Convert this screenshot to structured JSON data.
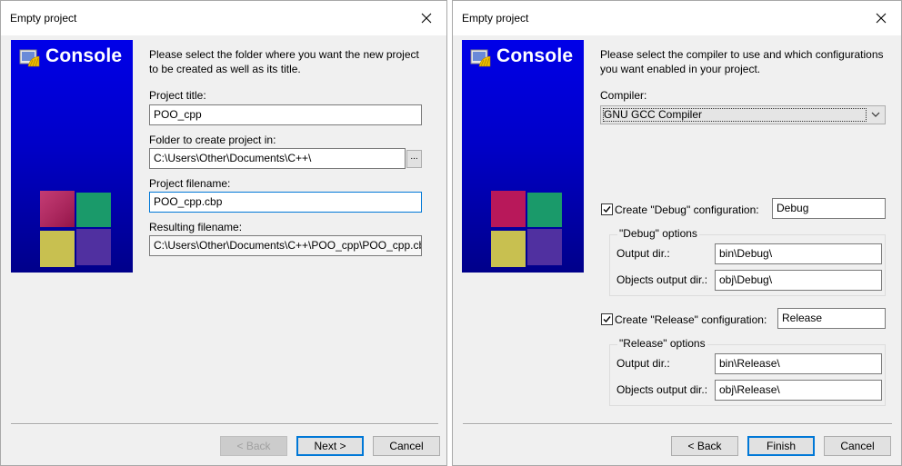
{
  "left": {
    "title": "Empty project",
    "banner_text": "Console",
    "intro": [
      "Please select the folder where you want the new project",
      "to be created as well as its title."
    ],
    "project_title": {
      "label": "Project title:",
      "value": "POO_cpp"
    },
    "folder": {
      "label": "Folder to create project in:",
      "value": "C:\\Users\\Other\\Documents\\C++\\",
      "browse": "..."
    },
    "filename": {
      "label": "Project filename:",
      "value": "POO_cpp.cbp"
    },
    "resulting": {
      "label": "Resulting filename:",
      "value": "C:\\Users\\Other\\Documents\\C++\\POO_cpp\\POO_cpp.cbp"
    },
    "buttons": {
      "back": "< Back",
      "next": "Next >",
      "cancel": "Cancel"
    }
  },
  "right": {
    "title": "Empty project",
    "banner_text": "Console",
    "intro": [
      "Please select the compiler to use and which configurations",
      "you want enabled in your project."
    ],
    "compiler": {
      "label": "Compiler:",
      "value": "GNU GCC Compiler"
    },
    "debug": {
      "checked": true,
      "check_label": "Create \"Debug\" configuration:",
      "name": "Debug",
      "group_title": "\"Debug\" options",
      "output_label": "Output dir.:",
      "output_value": "bin\\Debug\\",
      "objects_label": "Objects output dir.:",
      "objects_value": "obj\\Debug\\"
    },
    "release": {
      "checked": true,
      "check_label": "Create \"Release\" configuration:",
      "name": "Release",
      "group_title": "\"Release\" options",
      "output_label": "Output dir.:",
      "output_value": "bin\\Release\\",
      "objects_label": "Objects output dir.:",
      "objects_value": "obj\\Release\\"
    },
    "buttons": {
      "back": "< Back",
      "finish": "Finish",
      "cancel": "Cancel"
    }
  },
  "colors": {
    "banner": "#0000c8",
    "focus_border": "#0078d7",
    "dialog_bg": "#f0f0f0"
  },
  "icons": [
    "close-icon",
    "codeblocks-logo-icon",
    "codeblocks-cube-icon",
    "chevron-down-icon",
    "checkmark-icon"
  ]
}
